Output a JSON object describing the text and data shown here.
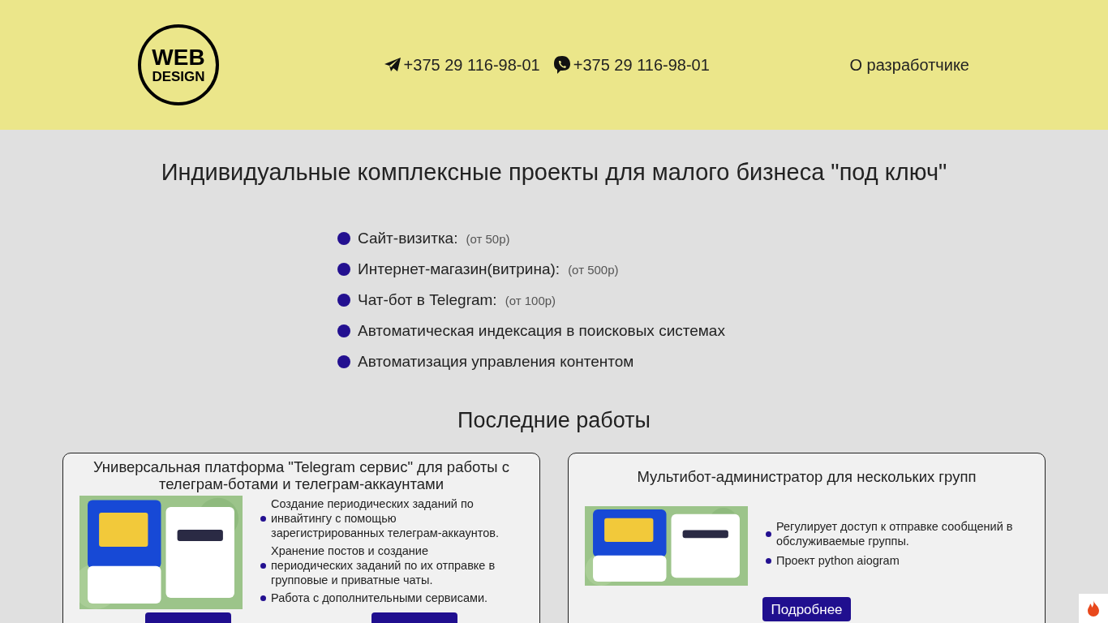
{
  "header": {
    "logo": {
      "line_1": "WEB",
      "line_2": "DESIGN"
    },
    "contacts": [
      {
        "kind": "telegram",
        "phone": "+375 29 116-98-01"
      },
      {
        "kind": "viber",
        "phone": "+375 29 116-98-01"
      }
    ],
    "nav_link": "О разработчике"
  },
  "headline": "Индивидуальные комплексные проекты для малого бизнеса \"под ключ\"",
  "services": [
    {
      "name": "Сайт-визитка:",
      "price": "(от 50р)"
    },
    {
      "name": "Интернет-магазин(витрина):",
      "price": "(от 500р)"
    },
    {
      "name": "Чат-бот в Telegram:",
      "price": "(от 100р)"
    },
    {
      "name": "Автоматическая индексация в поисковых системах"
    },
    {
      "name": "Автоматизация управления контентом"
    }
  ],
  "section_title": "Последние работы",
  "works": [
    {
      "title": "Универсальная платформа \"Telegram сервис\" для работы с телеграм-ботами и телеграм-аккаунтами",
      "image": {
        "kind": "picture"
      },
      "features": [
        "Создание периодических заданий по инвайтингу с помощью зарегистрированных телеграм-аккаунтов.",
        "Хранение постов и создание периодических заданий по их отправке в групповые и приватные чаты.",
        "Работа с дополнительными сервисами."
      ],
      "actions": [
        {
          "kind": "button"
        },
        {
          "kind": "button"
        }
      ]
    },
    {
      "title": "Мультибот-администратор для нескольких групп",
      "image": {
        "kind": "picture"
      },
      "features": [
        "Регулирует доступ к отправке сообщений в обслуживаемые группы.",
        "Проект python aiogram"
      ],
      "actions": [
        {
          "kind": "button",
          "label": "Подробнее"
        }
      ]
    }
  ]
}
